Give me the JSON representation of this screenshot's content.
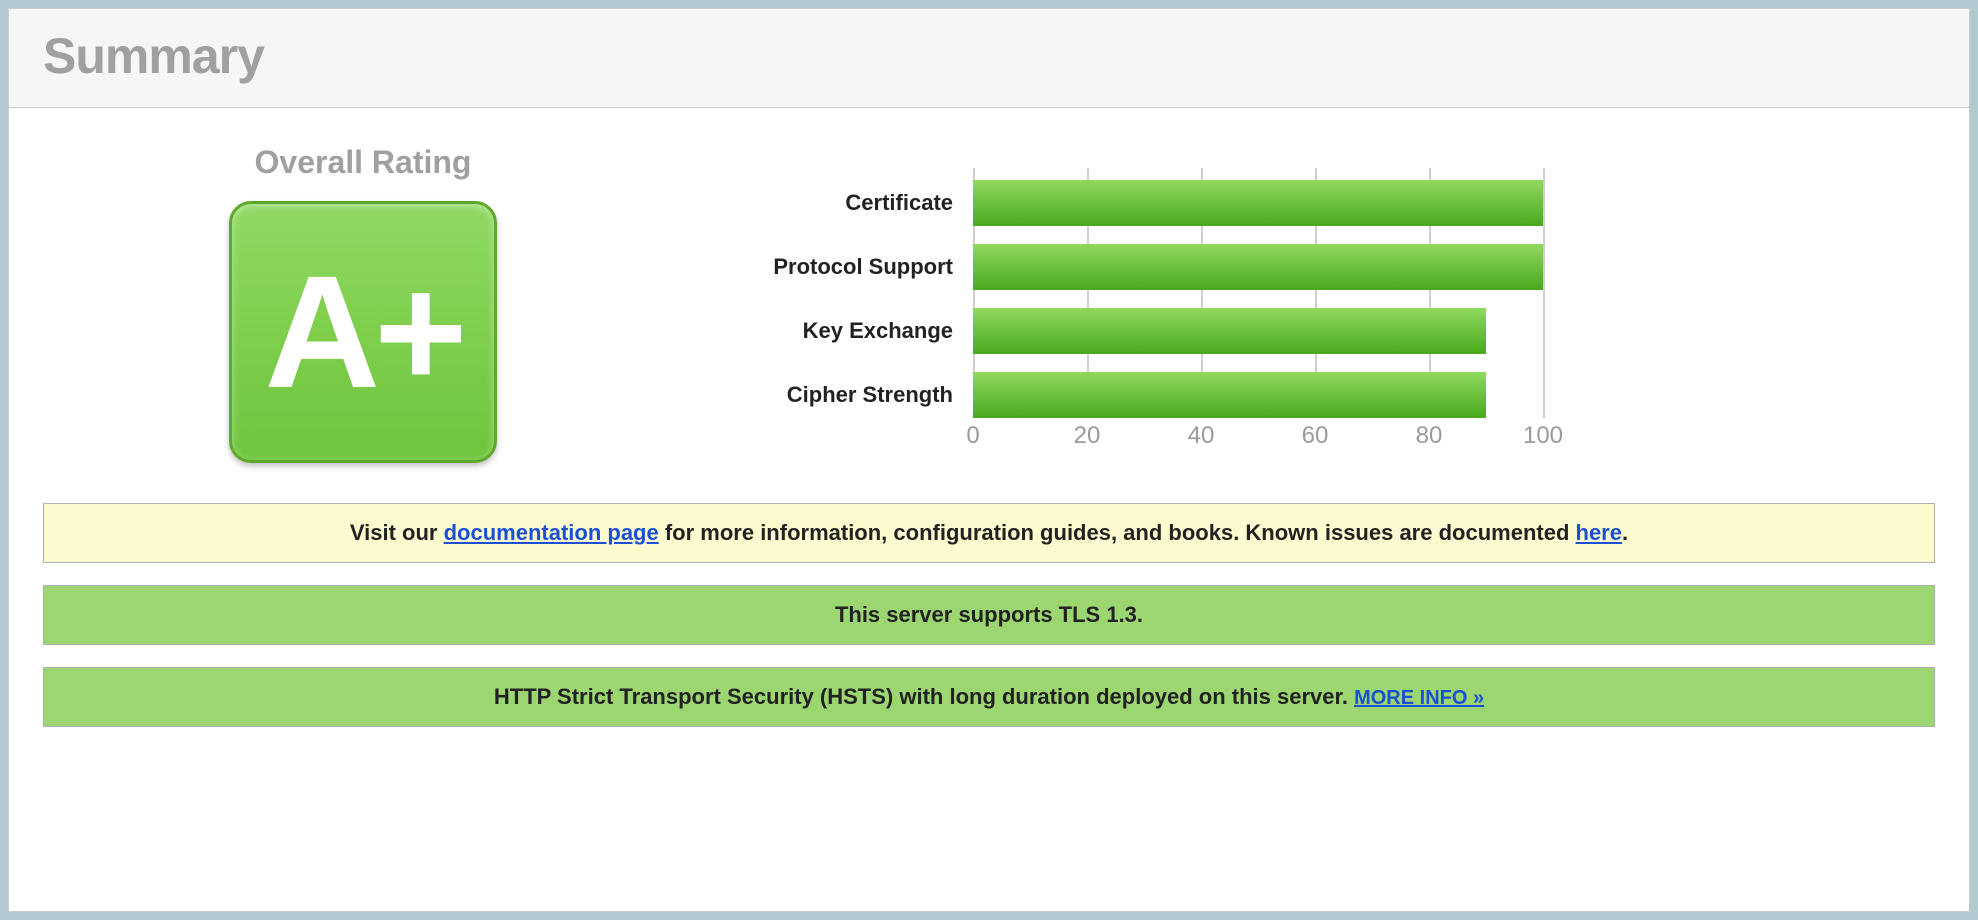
{
  "header": {
    "title": "Summary"
  },
  "rating": {
    "label": "Overall Rating",
    "grade": "A+"
  },
  "chart_data": {
    "type": "bar",
    "orientation": "horizontal",
    "categories": [
      "Certificate",
      "Protocol Support",
      "Key Exchange",
      "Cipher Strength"
    ],
    "values": [
      100,
      100,
      90,
      90
    ],
    "xlim": [
      0,
      100
    ],
    "ticks": [
      0,
      20,
      40,
      60,
      80,
      100
    ],
    "bar_color_gradient": [
      "#8fd95f",
      "#4aa81c"
    ]
  },
  "notices": {
    "doc": {
      "pre": "Visit our ",
      "link1": "documentation page",
      "mid": " for more information, configuration guides, and books. Known issues are documented ",
      "link2": "here",
      "post": "."
    },
    "tls": "This server supports TLS 1.3.",
    "hsts": {
      "text": "HTTP Strict Transport Security (HSTS) with long duration deployed on this server.  ",
      "more": "MORE INFO »"
    }
  }
}
